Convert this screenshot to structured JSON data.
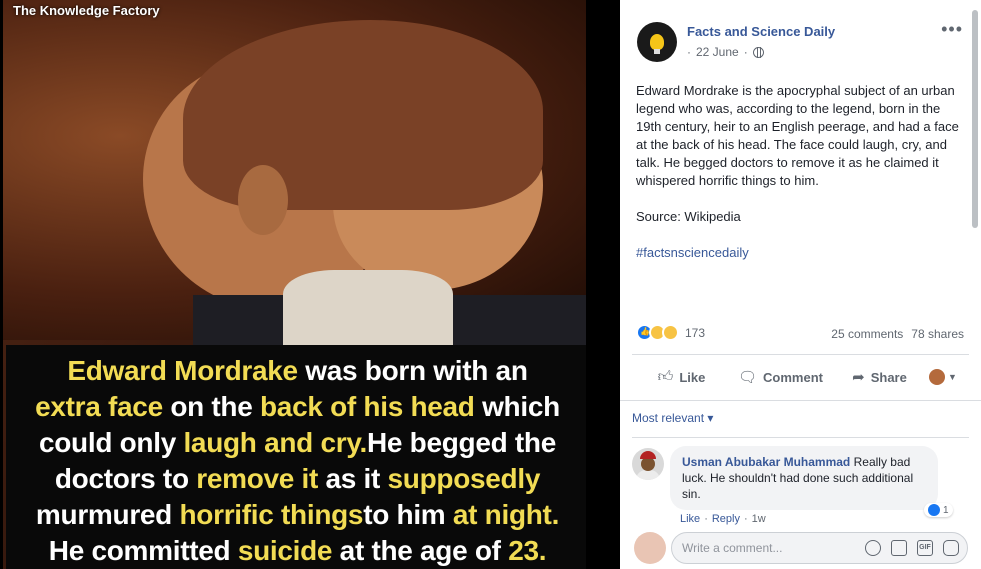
{
  "viewer": {
    "watermark": "The Knowledge Factory",
    "caption_lines": [
      [
        {
          "t": "Edward Mordrake",
          "hl": true
        },
        {
          "t": " was born with an",
          "hl": false
        }
      ],
      [
        {
          "t": "extra face",
          "hl": true
        },
        {
          "t": " on the ",
          "hl": false
        },
        {
          "t": "back of his head",
          "hl": true
        },
        {
          "t": " which",
          "hl": false
        }
      ],
      [
        {
          "t": "could only ",
          "hl": false
        },
        {
          "t": "laugh and cry.",
          "hl": true
        },
        {
          "t": "He begged the",
          "hl": false
        }
      ],
      [
        {
          "t": "doctors to ",
          "hl": false
        },
        {
          "t": "remove it",
          "hl": true
        },
        {
          "t": " as it ",
          "hl": false
        },
        {
          "t": "supposedly",
          "hl": true
        }
      ],
      [
        {
          "t": "murmured ",
          "hl": false
        },
        {
          "t": "horrific things",
          "hl": true
        },
        {
          "t": "to him ",
          "hl": false
        },
        {
          "t": "at night.",
          "hl": true
        }
      ],
      [
        {
          "t": "He committed ",
          "hl": false
        },
        {
          "t": "suicide",
          "hl": true
        },
        {
          "t": " at the age of ",
          "hl": false
        },
        {
          "t": "23.",
          "hl": true
        }
      ]
    ]
  },
  "post": {
    "page_name": "Facts and Science Daily",
    "date": "22 June",
    "separator": "·",
    "body": "Edward Mordrake is the apocryphal subject of an urban legend who was, according to the legend, born in the 19th century, heir to an English peerage, and had a face at the back of his head. The face could laugh, cry, and talk. He begged doctors to remove it as he claimed it whispered horrific things to him.",
    "source": "Source: Wikipedia",
    "hashtag": "#factsnsciencedaily",
    "more": "•••"
  },
  "stats": {
    "reaction_count": "173",
    "comments": "25 comments",
    "shares": "78 shares"
  },
  "actions": {
    "like": "Like",
    "comment": "Comment",
    "share": "Share",
    "like_icon": "thumbs-up-icon",
    "comment_icon": "speech-bubble-icon",
    "share_icon": "share-arrow-icon"
  },
  "comments": {
    "sort": "Most relevant ▾",
    "items": [
      {
        "author": "Usman Abubakar Muhammad",
        "text": "Really bad luck. He shouldn't had done such additional sin.",
        "like_link": "Like",
        "reply_link": "Reply",
        "time": "1w",
        "like_count": "1"
      }
    ],
    "composer_placeholder": "Write a comment..."
  },
  "colors": {
    "highlight": "#f2dc54",
    "link": "#385898",
    "meta": "#606770"
  }
}
